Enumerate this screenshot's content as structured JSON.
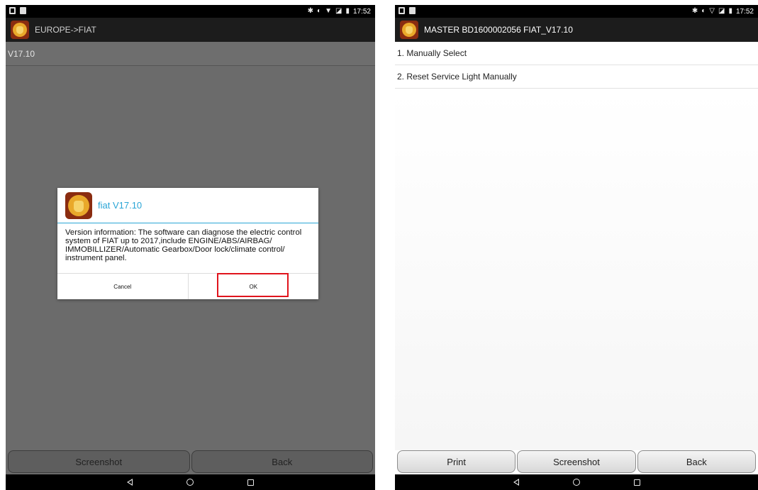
{
  "left_screen": {
    "status_time": "17:52",
    "title": "EUROPE->FIAT",
    "version_row": "V17.10",
    "dialog": {
      "title": "fiat V17.10",
      "message": "Version information: The software can diagnose the electric control system of FIAT up to 2017,include ENGINE/ABS/AIRBAG/ IMMOBILLIZER/Automatic Gearbox/Door lock/climate control/ instrument panel.",
      "cancel_label": "Cancel",
      "ok_label": "OK"
    },
    "buttons": {
      "screenshot": "Screenshot",
      "back": "Back"
    }
  },
  "right_screen": {
    "status_time": "17:52",
    "title": "MASTER BD1600002056 FIAT_V17.10",
    "menu_items": [
      "1. Manually Select",
      "2. Reset Service Light Manually"
    ],
    "buttons": {
      "print": "Print",
      "screenshot": "Screenshot",
      "back": "Back"
    }
  },
  "colors": {
    "accent": "#2aa5d6",
    "highlight_box": "#e0141c",
    "title_bar": "#1c1c1c"
  }
}
